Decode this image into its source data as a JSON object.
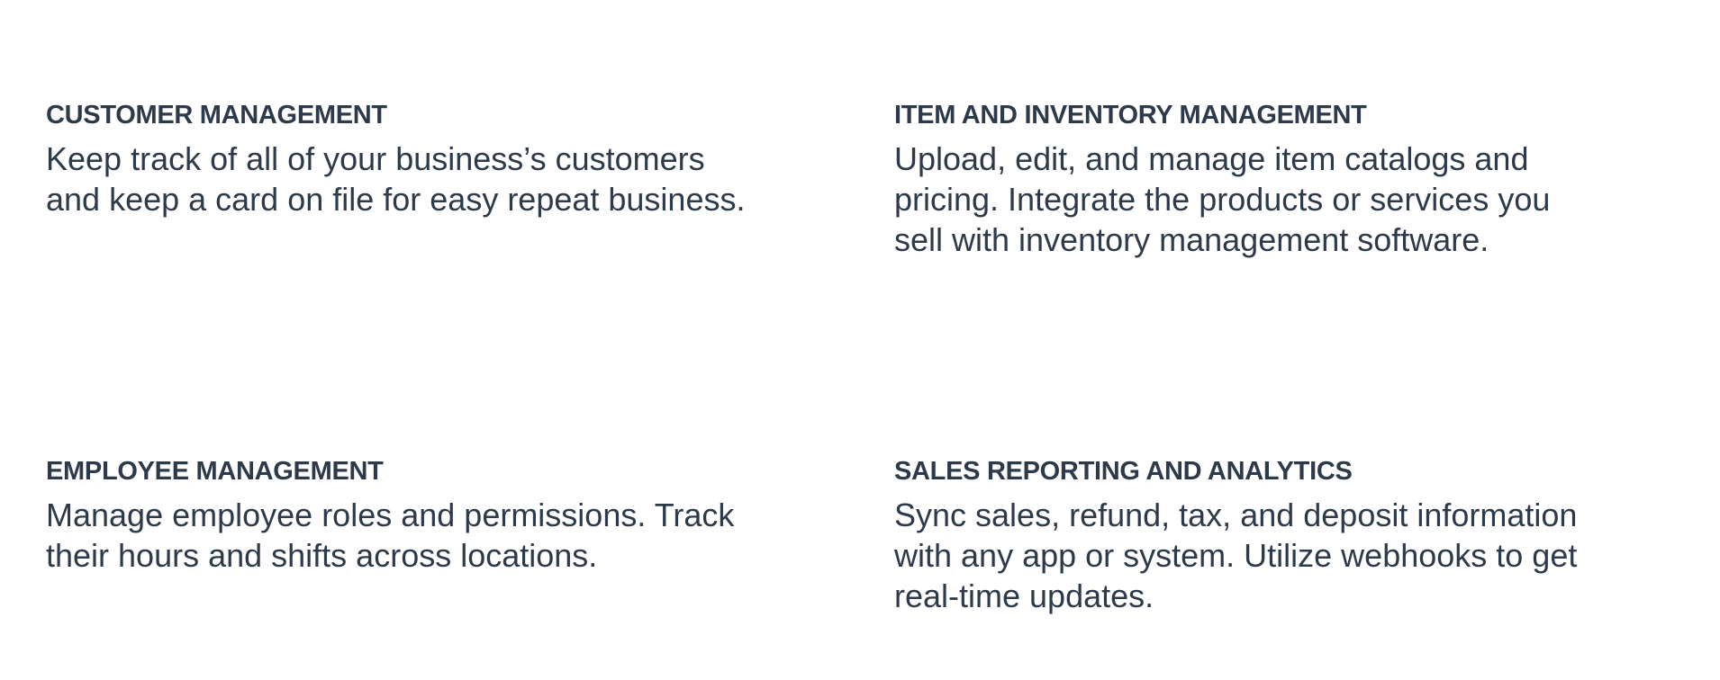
{
  "features": [
    {
      "title": "CUSTOMER MANAGEMENT",
      "description_lines": [
        "Keep track of all of your business’s customers",
        "and keep a card on file for easy repeat business."
      ]
    },
    {
      "title": "ITEM AND INVENTORY MANAGEMENT",
      "description_lines": [
        "Upload, edit, and manage item catalogs and",
        "pricing. Integrate the products or services you",
        "sell with inventory management software."
      ]
    },
    {
      "title": "EMPLOYEE MANAGEMENT",
      "description_lines": [
        "Manage employee roles and permissions. Track",
        "their hours and shifts across locations."
      ]
    },
    {
      "title": "SALES REPORTING AND ANALYTICS",
      "description_lines": [
        "Sync sales, refund, tax, and deposit information",
        "with any app or system. Utilize webhooks to get",
        "real-time updates."
      ]
    }
  ]
}
